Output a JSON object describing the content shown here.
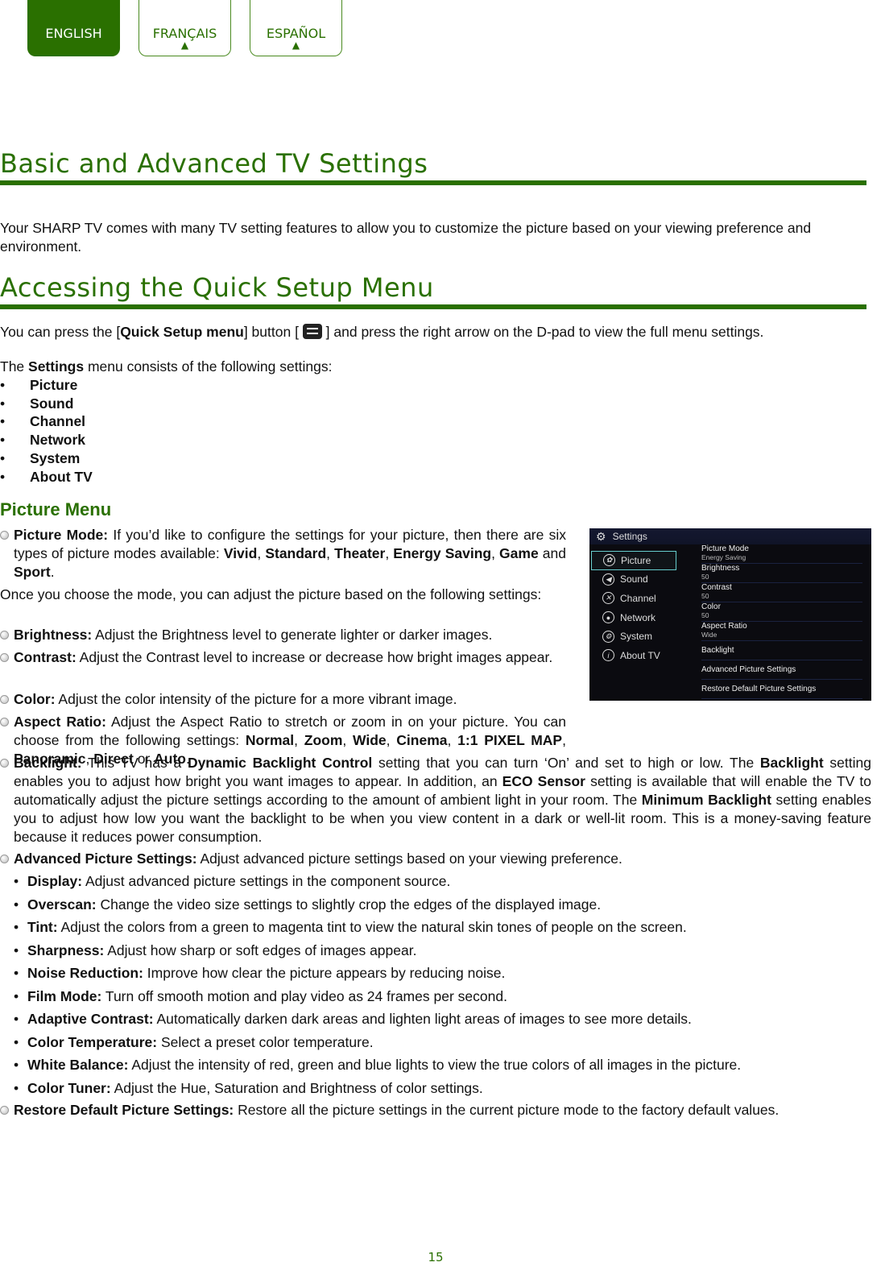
{
  "language_tabs": [
    {
      "label": "ENGLISH",
      "active": true
    },
    {
      "label": "FRANÇAIS",
      "arrow": "▲"
    },
    {
      "label": "ESPAÑOL",
      "arrow": "▲"
    }
  ],
  "section1": {
    "title": "Basic and Advanced TV Settings",
    "intro": [
      {
        "t": "Your SHARP TV comes with many TV setting features to allow you to customize the picture based on your viewing preference and environment."
      }
    ]
  },
  "section2": {
    "title": "Accessing the Quick Setup Menu",
    "p1a": [
      {
        "t": "You can press the ["
      },
      {
        "t": "Quick Setup menu",
        "b": true
      },
      {
        "t": "] button [ "
      }
    ],
    "p1_icon": "quick-setup-menu-icon",
    "p1b": [
      {
        "t": " ] and press the right arrow on the D-pad to view the full menu settings."
      }
    ],
    "p2": [
      {
        "t": "The "
      },
      {
        "t": "Settings",
        "b": true
      },
      {
        "t": " menu consists of the following settings:"
      }
    ],
    "list": [
      "Picture",
      "Sound",
      "Channel",
      "Network",
      "System",
      "About TV"
    ]
  },
  "picture_menu": {
    "title": "Picture Menu",
    "picture_mode": [
      {
        "t": "Picture Mode:",
        "b": true
      },
      {
        "t": " If you’d like to configure the settings for your picture, then there are six types of picture modes available: "
      },
      {
        "t": "Vivid",
        "b": true
      },
      {
        "t": ", "
      },
      {
        "t": "Standard",
        "b": true
      },
      {
        "t": ", "
      },
      {
        "t": "Theater",
        "b": true
      },
      {
        "t": ", "
      },
      {
        "t": "Energy Saving",
        "b": true
      },
      {
        "t": ", "
      },
      {
        "t": "Game",
        "b": true
      },
      {
        "t": " and "
      },
      {
        "t": "Sport",
        "b": true
      },
      {
        "t": "."
      }
    ],
    "once": [
      {
        "t": "Once you choose the mode, you can adjust the picture based on the following settings:"
      }
    ],
    "brightness": [
      {
        "t": "Brightness:",
        "b": true
      },
      {
        "t": " Adjust the Brightness level to generate lighter or darker images."
      }
    ],
    "contrast": [
      {
        "t": "Contrast:",
        "b": true
      },
      {
        "t": " Adjust the Contrast level to increase or decrease how bright images appear."
      }
    ],
    "color": [
      {
        "t": "Color:",
        "b": true
      },
      {
        "t": " Adjust the color intensity of the picture for a more vibrant image."
      }
    ],
    "aspect": [
      {
        "t": "Aspect Ratio:",
        "b": true
      },
      {
        "t": " Adjust the Aspect Ratio to stretch or zoom in on your picture. You can choose from the following settings: "
      },
      {
        "t": "Normal",
        "b": true
      },
      {
        "t": ", "
      },
      {
        "t": "Zoom",
        "b": true
      },
      {
        "t": ", "
      },
      {
        "t": "Wide",
        "b": true
      },
      {
        "t": ", "
      },
      {
        "t": "Cinema",
        "b": true
      },
      {
        "t": ", "
      },
      {
        "t": "1:1 PIXEL MAP",
        "b": true
      },
      {
        "t": ", "
      },
      {
        "t": "Panoramic",
        "b": true
      },
      {
        "t": ", "
      },
      {
        "t": "Direct",
        "b": true
      },
      {
        "t": " or "
      },
      {
        "t": "Auto",
        "b": true
      },
      {
        "t": "."
      }
    ],
    "backlight": [
      {
        "t": "Backlight:",
        "b": true
      },
      {
        "t": "  This TV has a "
      },
      {
        "t": "Dynamic Backlight Control",
        "b": true
      },
      {
        "t": " setting that you can turn ‘On’ and set to high or low. The "
      },
      {
        "t": "Backlight",
        "b": true
      },
      {
        "t": " setting enables you to adjust how bright you want images to appear. In addition, an "
      },
      {
        "t": "ECO Sensor",
        "b": true
      },
      {
        "t": " setting is available that will enable the TV to automatically adjust the picture settings according to the amount of ambient light in your room. The "
      },
      {
        "t": "Minimum Backlight",
        "b": true
      },
      {
        "t": " setting enables you to adjust how low you want the backlight to be when you view content in a dark or well-lit room. This is a money-saving feature because it reduces power consumption."
      }
    ],
    "advanced": [
      {
        "t": "Advanced Picture Settings:",
        "b": true
      },
      {
        "t": " Adjust  advanced picture settings based on your viewing preference."
      }
    ],
    "advanced_list": [
      [
        {
          "t": "Display:",
          "b": true
        },
        {
          "t": " Adjust advanced picture settings in the component source."
        }
      ],
      [
        {
          "t": "Overscan:",
          "b": true
        },
        {
          "t": " Change the video size settings to slightly crop the edges of the displayed image."
        }
      ],
      [
        {
          "t": "Tint:",
          "b": true
        },
        {
          "t": " Adjust the colors from a green to magenta tint to view the natural skin tones of people on the screen."
        }
      ],
      [
        {
          "t": "Sharpness:",
          "b": true
        },
        {
          "t": " Adjust how sharp or soft edges of images appear."
        }
      ],
      [
        {
          "t": "Noise Reduction:",
          "b": true
        },
        {
          "t": " Improve how clear the picture appears by reducing noise."
        }
      ],
      [
        {
          "t": "Film Mode:",
          "b": true
        },
        {
          "t": " Turn off smooth motion and play video as 24 frames per second."
        }
      ],
      [
        {
          "t": "Adaptive Contrast:",
          "b": true
        },
        {
          "t": " Automatically darken dark areas and lighten light areas of images to see more details."
        }
      ],
      [
        {
          "t": "Color Temperature:",
          "b": true
        },
        {
          "t": " Select a preset color temperature."
        }
      ],
      [
        {
          "t": "White Balance:",
          "b": true
        },
        {
          "t": " Adjust the intensity of red, green and blue lights to view the true colors of all images in the picture."
        }
      ],
      [
        {
          "t": "Color Tuner:",
          "b": true
        },
        {
          "t": " Adjust the Hue, Saturation and Brightness of color settings."
        }
      ]
    ],
    "restore": [
      {
        "t": "Restore Default Picture Settings:",
        "b": true
      },
      {
        "t": " Restore all the picture settings in the current picture mode to the factory default values."
      }
    ]
  },
  "tv_screen": {
    "header": "Settings",
    "menu": [
      {
        "label": "Picture",
        "icon": "picture-icon",
        "glyph": "✿",
        "selected": true
      },
      {
        "label": "Sound",
        "icon": "sound-icon",
        "glyph": "◀"
      },
      {
        "label": "Channel",
        "icon": "channel-icon",
        "glyph": "✕"
      },
      {
        "label": "Network",
        "icon": "network-icon",
        "glyph": "●"
      },
      {
        "label": "System",
        "icon": "system-icon",
        "glyph": "⚙"
      },
      {
        "label": "About TV",
        "icon": "info-icon",
        "glyph": "i"
      }
    ],
    "items": [
      {
        "name": "Picture Mode",
        "value": "Energy Saving"
      },
      {
        "name": "Brightness",
        "value": "50"
      },
      {
        "name": "Contrast",
        "value": "50"
      },
      {
        "name": "Color",
        "value": "50"
      },
      {
        "name": "Aspect Ratio",
        "value": "Wide"
      },
      {
        "name": "Backlight"
      },
      {
        "name": "Advanced Picture Settings"
      },
      {
        "name": "Restore Default Picture Settings"
      }
    ]
  },
  "page_number": "15",
  "colors": {
    "brand_green": "#2a7000"
  }
}
